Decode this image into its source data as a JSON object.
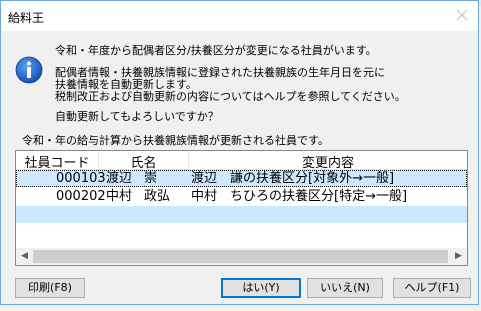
{
  "dialog": {
    "title": "給料王"
  },
  "message": {
    "line1": "令和・年度から配偶者区分/扶養区分が変更になる社員がいます。",
    "line2": "配偶者情報・扶養親族情報に登録された扶養親族の生年月日を元に",
    "line3": "扶養情報を自動更新します。",
    "line4": "税制改正および自動更新の内容についてはヘルプを参照してください。",
    "question": "自動更新してもよろしいですか？",
    "list_caption": "令和・年の給与計算から扶養親族情報が更新される社員です。"
  },
  "list": {
    "columns": [
      "社員コード",
      "氏名",
      "変更内容"
    ],
    "rows": [
      {
        "code": "000103",
        "last": "渡辺",
        "first": "崇",
        "change": "渡辺　謙の扶養区分[対象外→一般]"
      },
      {
        "code": "000202",
        "last": "中村",
        "first": "政弘",
        "change": "中村　ちひろの扶養区分[特定→一般]"
      }
    ],
    "selected_row": 0
  },
  "buttons": {
    "print": "印刷(F8)",
    "yes": "はい(Y)",
    "no": "いいえ(N)",
    "help": "ヘルプ(F1)"
  },
  "colors": {
    "selection": "#cde8ff",
    "alt_row": "#cce8ff",
    "border": "#6fa8dc"
  },
  "icons": {
    "info": "info-icon",
    "close": "close-icon"
  }
}
